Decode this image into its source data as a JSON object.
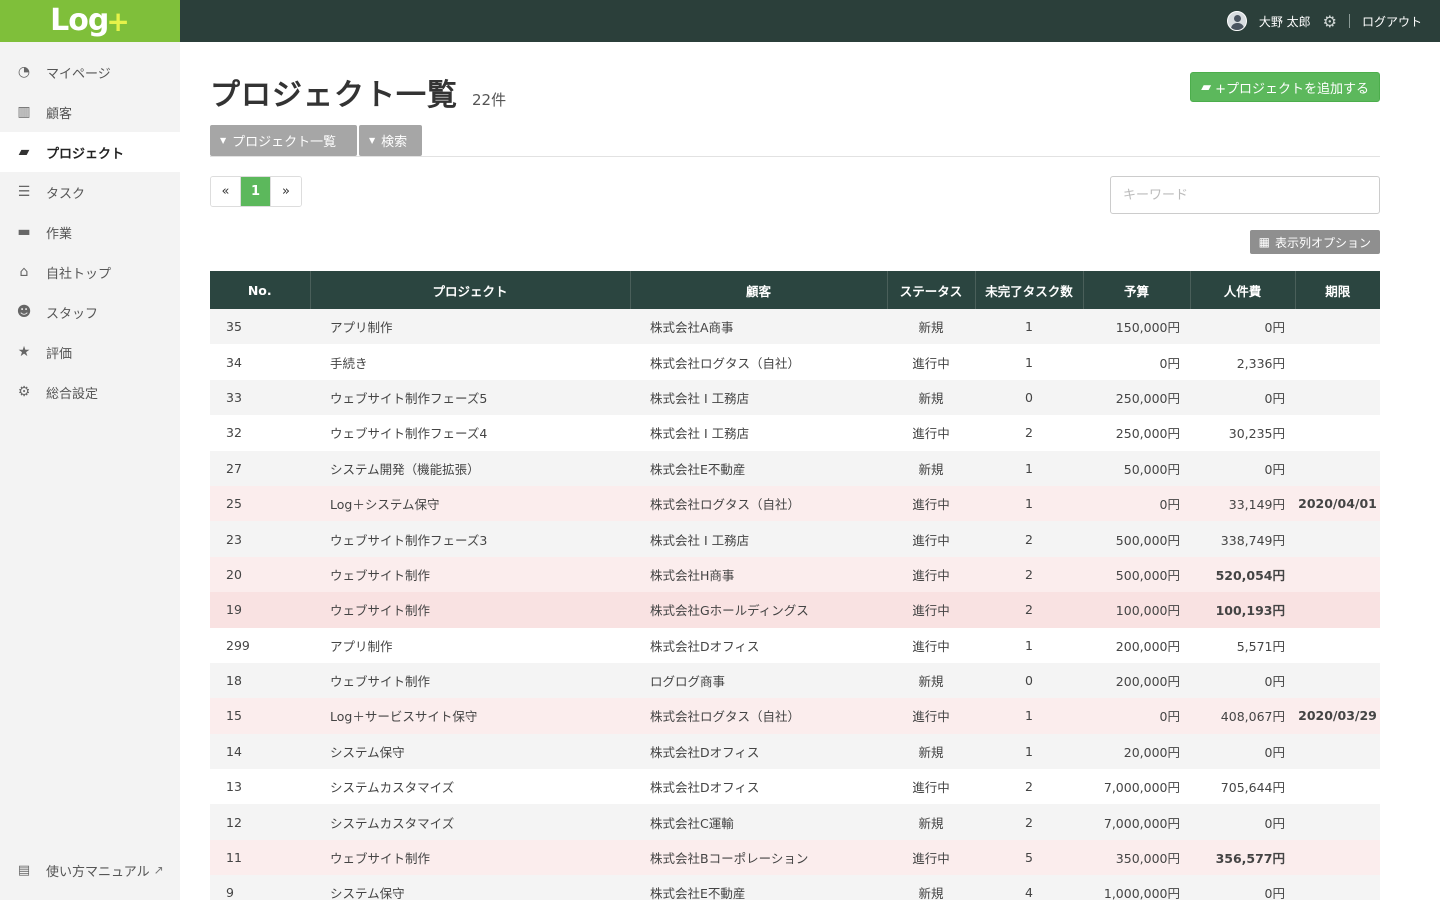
{
  "header": {
    "logo_text": "Log",
    "logo_plus": "+",
    "user_name": "大野 太郎",
    "logout": "ログアウト"
  },
  "sidebar": {
    "items": [
      {
        "label": "マイページ",
        "icon": "dashboard-icon",
        "glyph": "◔"
      },
      {
        "label": "顧客",
        "icon": "building-icon",
        "glyph": "▥"
      },
      {
        "label": "プロジェクト",
        "icon": "folder-open-icon",
        "glyph": "▰"
      },
      {
        "label": "タスク",
        "icon": "list-icon",
        "glyph": "☰"
      },
      {
        "label": "作業",
        "icon": "briefcase-icon",
        "glyph": "▬"
      },
      {
        "label": "自社トップ",
        "icon": "home-icon",
        "glyph": "⌂"
      },
      {
        "label": "スタッフ",
        "icon": "users-icon",
        "glyph": "☻"
      },
      {
        "label": "評価",
        "icon": "star-icon",
        "glyph": "★"
      },
      {
        "label": "総合設定",
        "icon": "gear-icon",
        "glyph": "⚙"
      }
    ],
    "manual": "使い方マニュアル"
  },
  "main": {
    "title": "プロジェクト一覧",
    "count": "22件",
    "add_button": "+プロジェクトを追加する",
    "tabs": [
      "プロジェクト一覧",
      "検索"
    ],
    "pager": {
      "prev": "«",
      "current": "1",
      "next": "»"
    },
    "search_placeholder": "キーワード",
    "column_options": "表示列オプション"
  },
  "table": {
    "headers": [
      "No.",
      "プロジェクト",
      "顧客",
      "ステータス",
      "未完了タスク数",
      "予算",
      "人件費",
      "期限"
    ],
    "rows": [
      {
        "no": "35",
        "project": "アプリ制作",
        "customer": "株式会社A商事",
        "status": "新規",
        "tasks": "1",
        "budget": "150,000円",
        "labor": "0円",
        "due": "",
        "labor_alert": false,
        "row_alert": ""
      },
      {
        "no": "34",
        "project": "手続き",
        "customer": "株式会社ログタス（自社）",
        "status": "進行中",
        "tasks": "1",
        "budget": "0円",
        "labor": "2,336円",
        "due": "",
        "labor_alert": false,
        "row_alert": ""
      },
      {
        "no": "33",
        "project": "ウェブサイト制作フェーズ5",
        "customer": "株式会社 I 工務店",
        "status": "新規",
        "tasks": "0",
        "budget": "250,000円",
        "labor": "0円",
        "due": "",
        "labor_alert": false,
        "row_alert": ""
      },
      {
        "no": "32",
        "project": "ウェブサイト制作フェーズ4",
        "customer": "株式会社 I 工務店",
        "status": "進行中",
        "tasks": "2",
        "budget": "250,000円",
        "labor": "30,235円",
        "due": "",
        "labor_alert": false,
        "row_alert": ""
      },
      {
        "no": "27",
        "project": "システム開発（機能拡張）",
        "customer": "株式会社E不動産",
        "status": "新規",
        "tasks": "1",
        "budget": "50,000円",
        "labor": "0円",
        "due": "",
        "labor_alert": false,
        "row_alert": ""
      },
      {
        "no": "25",
        "project": "Log＋システム保守",
        "customer": "株式会社ログタス（自社）",
        "status": "進行中",
        "tasks": "1",
        "budget": "0円",
        "labor": "33,149円",
        "due": "2020/04/01",
        "labor_alert": false,
        "row_alert": "alert"
      },
      {
        "no": "23",
        "project": "ウェブサイト制作フェーズ3",
        "customer": "株式会社 I 工務店",
        "status": "進行中",
        "tasks": "2",
        "budget": "500,000円",
        "labor": "338,749円",
        "due": "",
        "labor_alert": false,
        "row_alert": ""
      },
      {
        "no": "20",
        "project": "ウェブサイト制作",
        "customer": "株式会社H商事",
        "status": "進行中",
        "tasks": "2",
        "budget": "500,000円",
        "labor": "520,054円",
        "due": "",
        "labor_alert": true,
        "row_alert": "alert"
      },
      {
        "no": "19",
        "project": "ウェブサイト制作",
        "customer": "株式会社Gホールディングス",
        "status": "進行中",
        "tasks": "2",
        "budget": "100,000円",
        "labor": "100,193円",
        "due": "",
        "labor_alert": true,
        "row_alert": "alert2"
      },
      {
        "no": "299",
        "project": "アプリ制作",
        "customer": "株式会社Dオフィス",
        "status": "進行中",
        "tasks": "1",
        "budget": "200,000円",
        "labor": "5,571円",
        "due": "",
        "labor_alert": false,
        "row_alert": ""
      },
      {
        "no": "18",
        "project": "ウェブサイト制作",
        "customer": "ログログ商事",
        "status": "新規",
        "tasks": "0",
        "budget": "200,000円",
        "labor": "0円",
        "due": "",
        "labor_alert": false,
        "row_alert": ""
      },
      {
        "no": "15",
        "project": "Log＋サービスサイト保守",
        "customer": "株式会社ログタス（自社）",
        "status": "進行中",
        "tasks": "1",
        "budget": "0円",
        "labor": "408,067円",
        "due": "2020/03/29",
        "labor_alert": false,
        "row_alert": "alert"
      },
      {
        "no": "14",
        "project": "システム保守",
        "customer": "株式会社Dオフィス",
        "status": "新規",
        "tasks": "1",
        "budget": "20,000円",
        "labor": "0円",
        "due": "",
        "labor_alert": false,
        "row_alert": ""
      },
      {
        "no": "13",
        "project": "システムカスタマイズ",
        "customer": "株式会社Dオフィス",
        "status": "進行中",
        "tasks": "2",
        "budget": "7,000,000円",
        "labor": "705,644円",
        "due": "",
        "labor_alert": false,
        "row_alert": ""
      },
      {
        "no": "12",
        "project": "システムカスタマイズ",
        "customer": "株式会社C運輸",
        "status": "新規",
        "tasks": "2",
        "budget": "7,000,000円",
        "labor": "0円",
        "due": "",
        "labor_alert": false,
        "row_alert": ""
      },
      {
        "no": "11",
        "project": "ウェブサイト制作",
        "customer": "株式会社Bコーポレーション",
        "status": "進行中",
        "tasks": "5",
        "budget": "350,000円",
        "labor": "356,577円",
        "due": "",
        "labor_alert": true,
        "row_alert": "alert"
      },
      {
        "no": "9",
        "project": "システム保守",
        "customer": "株式会社E不動産",
        "status": "新規",
        "tasks": "4",
        "budget": "1,000,000円",
        "labor": "0円",
        "due": "",
        "labor_alert": false,
        "row_alert": ""
      }
    ]
  },
  "colors": {
    "topbar": "#2b3f3a",
    "logo_bg": "#7fbf3a",
    "accent_green": "#5cb85c",
    "table_header": "#2b4540",
    "alert_text": "#b01c1c"
  }
}
